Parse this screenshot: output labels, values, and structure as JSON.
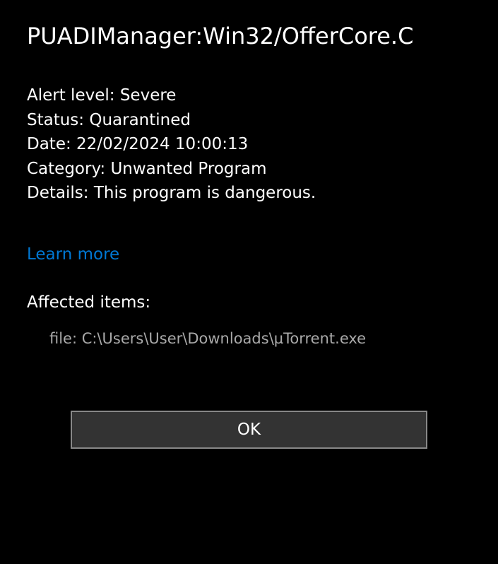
{
  "title": "PUADIManager:Win32/OfferCore.C",
  "details": {
    "alert_level_label": "Alert level:",
    "alert_level_value": "Severe",
    "status_label": "Status:",
    "status_value": "Quarantined",
    "date_label": "Date:",
    "date_value": "22/02/2024 10:00:13",
    "category_label": "Category:",
    "category_value": "Unwanted Program",
    "details_label": "Details:",
    "details_value": "This program is dangerous."
  },
  "learn_more": "Learn more",
  "affected_heading": "Affected items:",
  "affected_item": "file: C:\\Users\\User\\Downloads\\µTorrent.exe",
  "ok_button": "OK"
}
